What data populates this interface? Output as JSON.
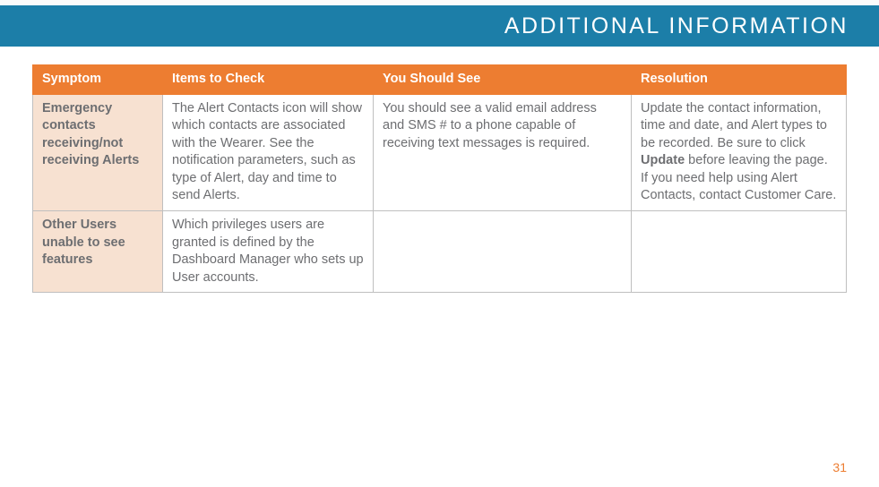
{
  "header": {
    "title": "ADDITIONAL INFORMATION"
  },
  "table": {
    "columns": {
      "symptom": "Symptom",
      "items": "Items to Check",
      "see": "You Should See",
      "resolution": "Resolution"
    },
    "rows": [
      {
        "symptom": "Emergency contacts receiving/not receiving Alerts",
        "items": "The Alert Contacts icon will show which contacts are associated with the Wearer. See the notification parameters, such as type of Alert, day and time to send Alerts.",
        "see": "You should see a valid email address and SMS # to a phone capable of receiving text messages is required.",
        "resolution_pre": "Update the contact information, time and date, and Alert types to be recorded. Be sure to click ",
        "resolution_bold": "Update",
        "resolution_post": " before leaving the page. If you need help using Alert Contacts, contact Customer Care."
      },
      {
        "symptom": "Other Users unable to see features",
        "items": "Which privileges users are granted is defined by the Dashboard Manager who sets up User accounts.",
        "see": "",
        "resolution_pre": "",
        "resolution_bold": "",
        "resolution_post": ""
      }
    ]
  },
  "page_number": "31"
}
